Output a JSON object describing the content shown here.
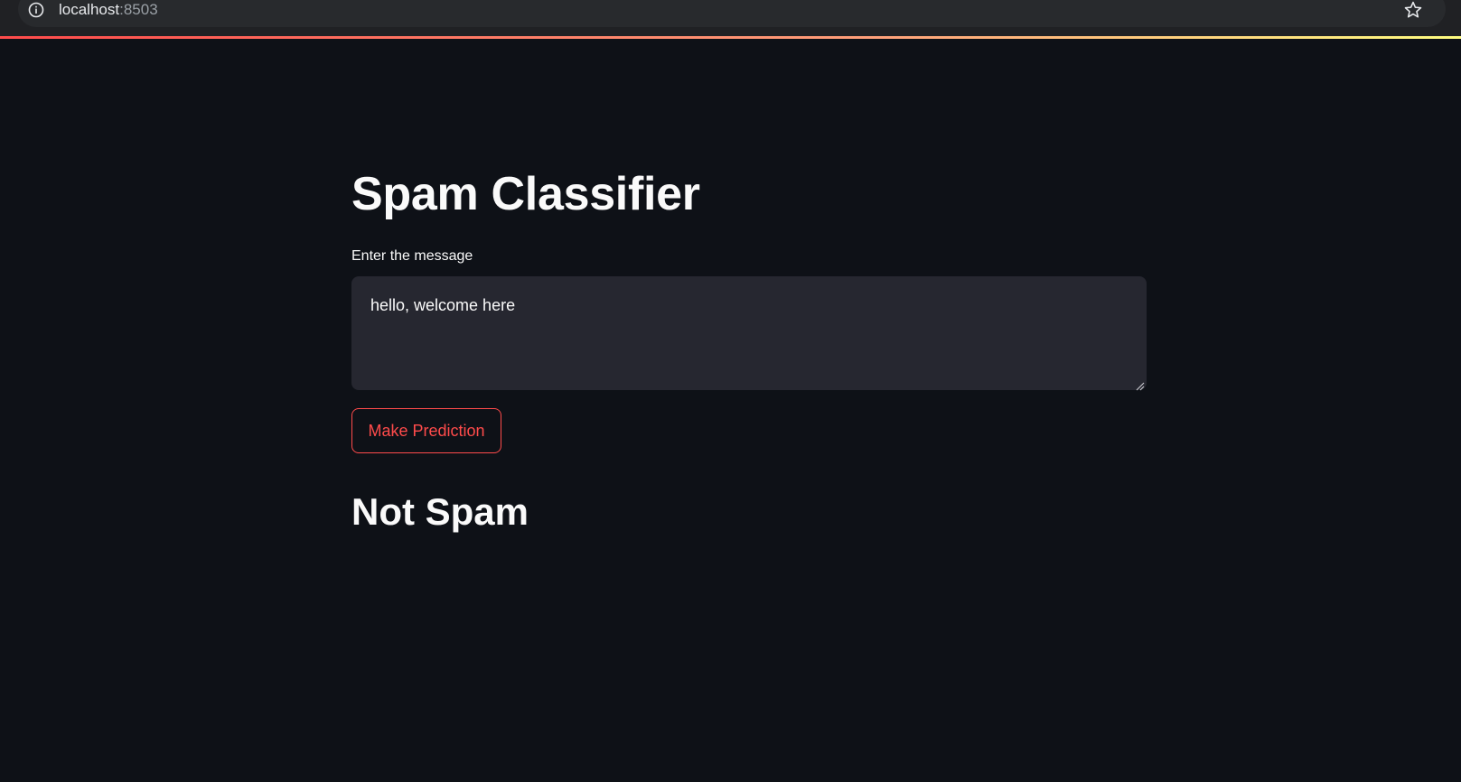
{
  "browser": {
    "host": "localhost",
    "port": ":8503",
    "info_icon": "info-icon",
    "star_icon": "star-icon"
  },
  "app": {
    "title": "Spam Classifier",
    "input": {
      "label": "Enter the message",
      "value": "hello, welcome here"
    },
    "button_label": "Make Prediction",
    "result": "Not Spam"
  },
  "colors": {
    "background": "#0e1117",
    "input_background": "#262730",
    "accent": "#ff4b4b",
    "text": "#fafafa"
  }
}
